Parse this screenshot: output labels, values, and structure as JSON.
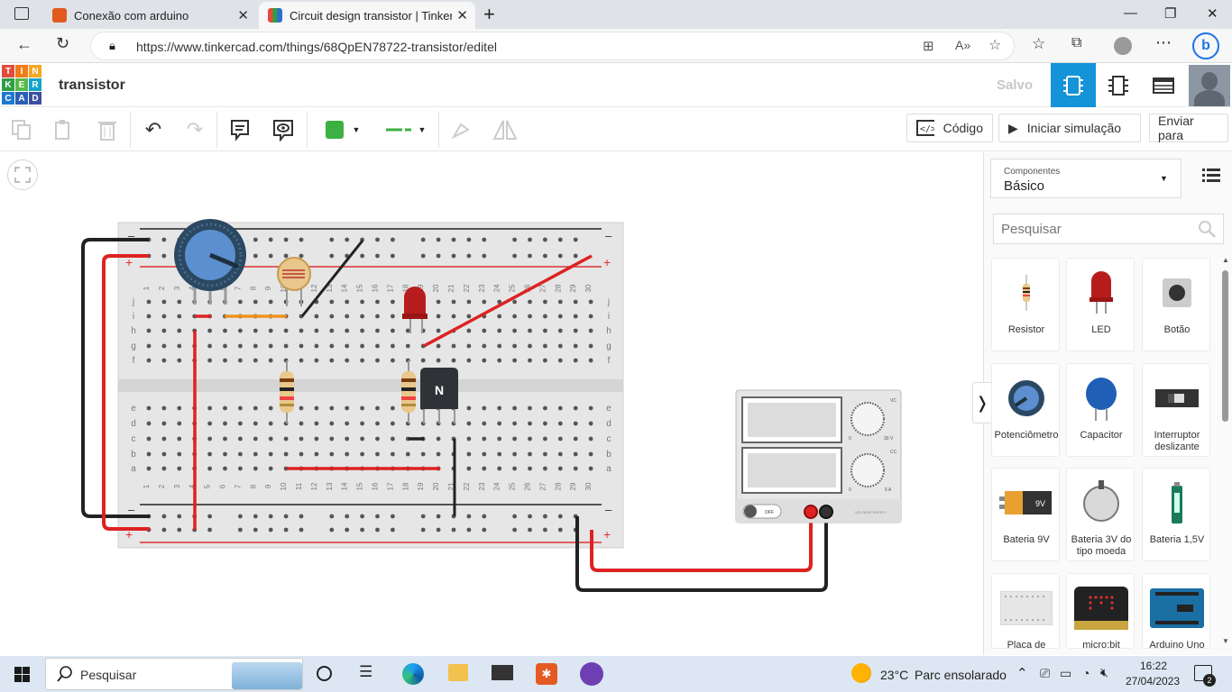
{
  "browser": {
    "tabs": [
      {
        "title": "Conexão com arduino",
        "icon": "tinkercad-orange-icon"
      },
      {
        "title": "Circuit design transistor | Tinkerc",
        "icon": "tinkercad-grid-icon"
      }
    ],
    "url": "https://www.tinkercad.com/things/68QpEN78722-transistor/editel"
  },
  "app": {
    "logo_letters": [
      "T",
      "I",
      "N",
      "K",
      "E",
      "R",
      "C",
      "A",
      "D"
    ],
    "title": "transistor",
    "save_status": "Salvo"
  },
  "toolbar": {
    "code_label": "Código",
    "simulate_label": "Iniciar simulação",
    "send_label": "Enviar para",
    "fill_color": "#3cb043",
    "wire_color": "#3cb043"
  },
  "panel": {
    "components_small": "Componentes",
    "components_selected": "Básico",
    "search_placeholder": "Pesquisar",
    "items": [
      {
        "label": "Resistor"
      },
      {
        "label": "LED"
      },
      {
        "label": "Botão"
      },
      {
        "label": "Potenciômetro"
      },
      {
        "label": "Capacitor"
      },
      {
        "label": "Interruptor deslizante"
      },
      {
        "label": "Bateria 9V"
      },
      {
        "label": "Bateria 3V do tipo moeda"
      },
      {
        "label": "Bateria 1,5V"
      },
      {
        "label": "Placa de"
      },
      {
        "label": "micro:bit"
      },
      {
        "label": "Arduino Uno"
      }
    ]
  },
  "circuit": {
    "breadboard_columns": [
      "1",
      "2",
      "3",
      "4",
      "5",
      "6",
      "7",
      "8",
      "9",
      "10",
      "11",
      "12",
      "13",
      "14",
      "15",
      "16",
      "17",
      "18",
      "19",
      "20",
      "21",
      "22",
      "23",
      "24",
      "25",
      "26",
      "27",
      "28",
      "29",
      "30"
    ],
    "rows_top": [
      "j",
      "i",
      "h",
      "g",
      "f"
    ],
    "rows_bottom": [
      "e",
      "d",
      "c",
      "b",
      "a"
    ],
    "rail_minus": "–",
    "rail_plus": "+",
    "transistor_label": "N",
    "battery_label": "9V",
    "psu_switch": "OFF",
    "psu_v": "30 V",
    "psu_a": "5 A",
    "psu_zero": "0",
    "psu_vc": "VC",
    "psu_cc": "CC",
    "psu_brand": "VOLTAGE SUPPLY"
  },
  "taskbar": {
    "search": "Pesquisar",
    "weather_temp": "23°C",
    "weather_text": "Parc ensolarado",
    "time": "16:22",
    "date": "27/04/2023",
    "notifications": "2"
  }
}
